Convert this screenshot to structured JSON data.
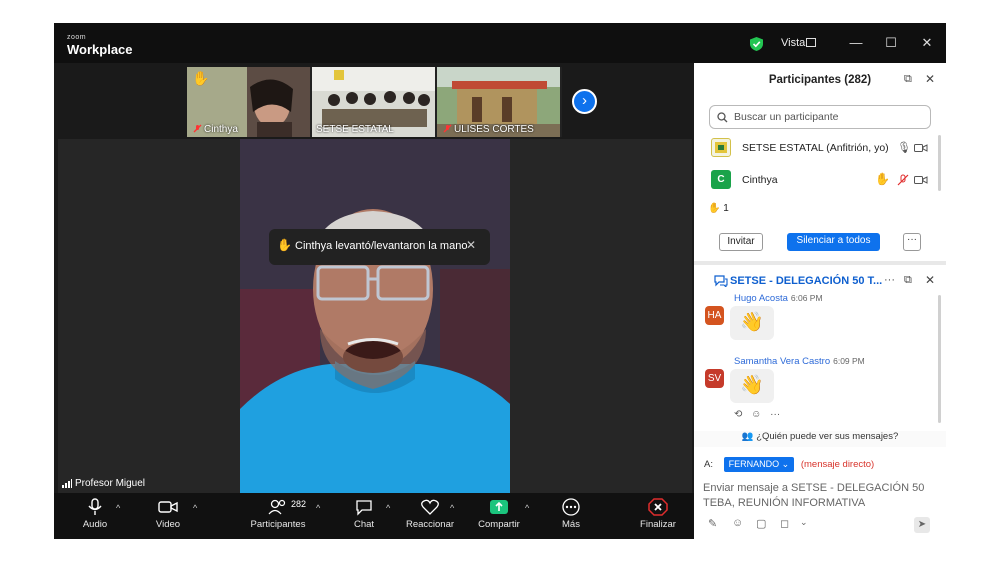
{
  "app": {
    "brand_small": "zoom",
    "brand_name": "Workplace",
    "view_label": "Vista"
  },
  "strip": {
    "thumbs": [
      {
        "label": "Cinthya",
        "hand": "✋"
      },
      {
        "label": "SETSE ESTATAL"
      },
      {
        "label": "ULISES CORTES"
      }
    ]
  },
  "main": {
    "speaker_name": "Profesor Miguel",
    "toast": {
      "icon": "✋",
      "text": "Cinthya levantó/levantaron la mano",
      "close": "✕"
    }
  },
  "toolbar": {
    "audio": "Audio",
    "video": "Video",
    "participants": "Participantes",
    "participants_count": "282",
    "chat": "Chat",
    "react": "Reaccionar",
    "share": "Compartir",
    "more": "Más",
    "end": "Finalizar"
  },
  "participants": {
    "title": "Participantes (282)",
    "search_placeholder": "Buscar un participante",
    "rows": [
      {
        "name": "SETSE ESTATAL (Anfitrión, yo)",
        "avatar": ""
      },
      {
        "name": "Cinthya",
        "avatar": "C",
        "avatar_color": "#1aa34a"
      }
    ],
    "raised_hands": {
      "icon": "✋",
      "count": "1"
    },
    "invite_label": "Invitar",
    "mute_all_label": "Silenciar a todos",
    "more_label": "···"
  },
  "chat": {
    "title": "SETSE - DELEGACIÓN 50 T...",
    "messages": [
      {
        "initials": "HA",
        "avatar_color": "#d4541f",
        "name": "Hugo Acosta",
        "time": "6:06 PM",
        "emoji": "👋"
      },
      {
        "initials": "SV",
        "avatar_color": "#c53a2a",
        "name": "Samantha Vera Castro",
        "time": "6:09 PM",
        "emoji": "👋"
      }
    ],
    "who_can_see": "¿Quién puede ver sus mensajes?",
    "to_label": "A:",
    "recipient": "FERNANDO",
    "direct_label": "(mensaje directo)",
    "compose_placeholder": "Enviar mensaje a SETSE - DELEGACIÓN 50 TEBA, REUNIÓN INFORMATIVA"
  },
  "colors": {
    "accent": "#0e72ed",
    "end_red": "#e02d2d",
    "share_green": "#1bc47d"
  }
}
